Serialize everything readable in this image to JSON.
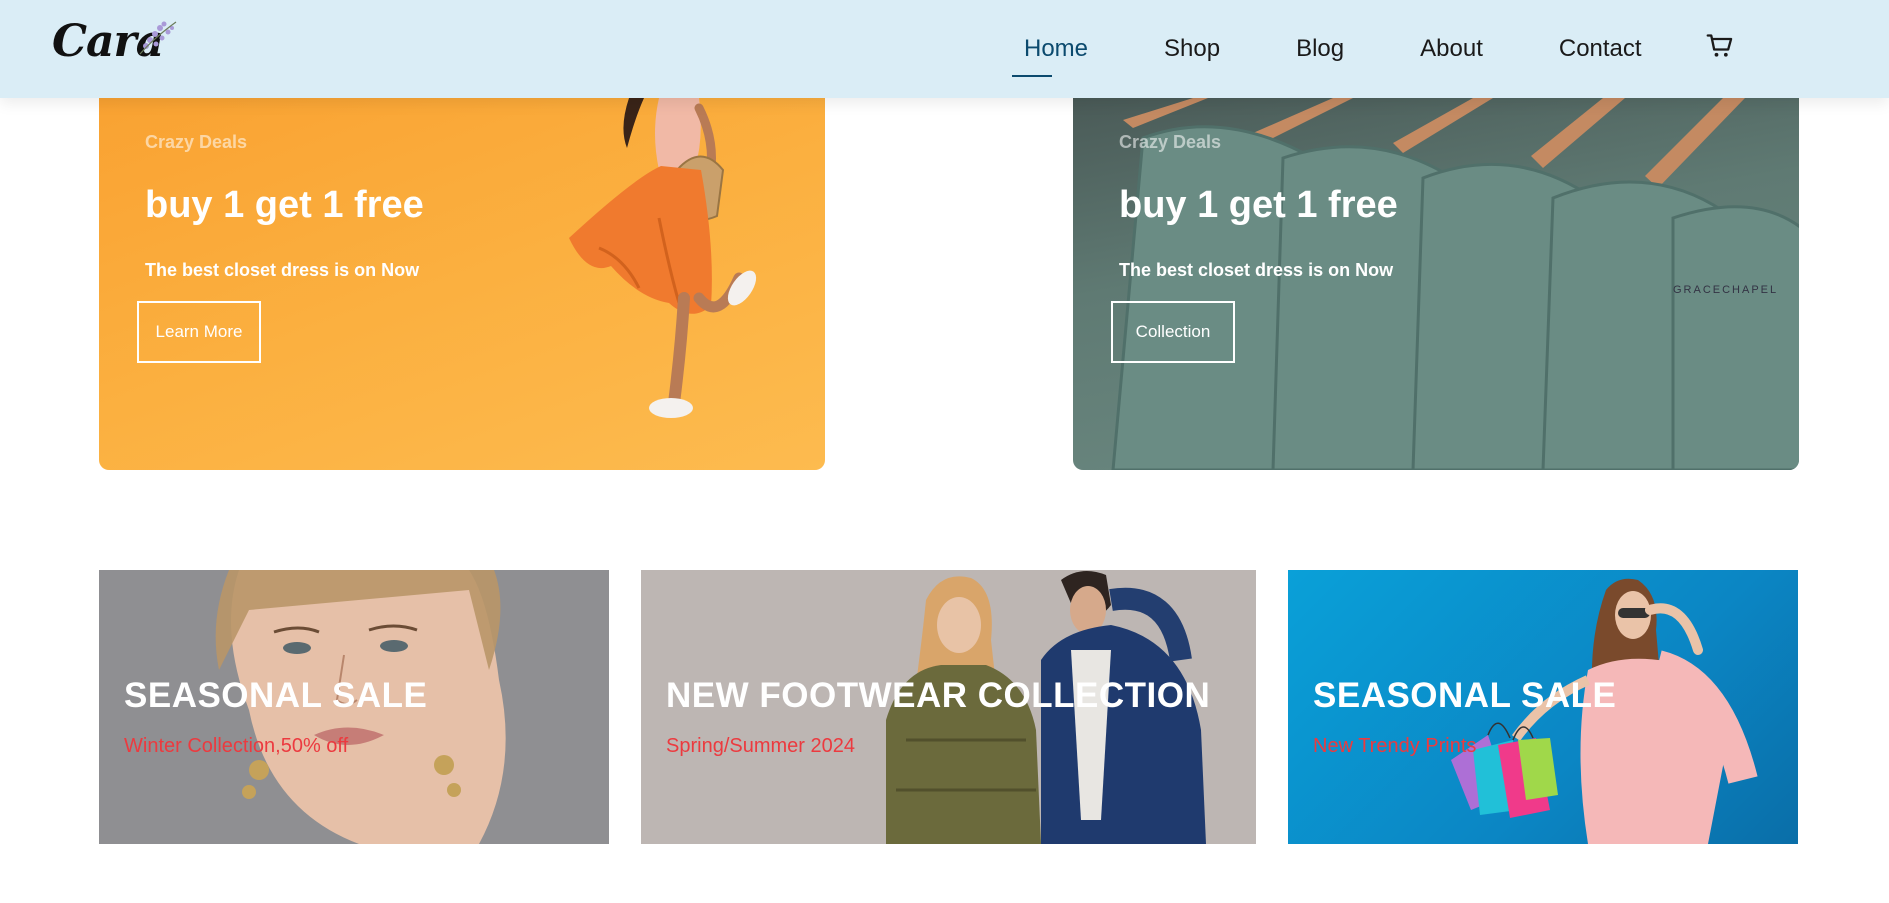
{
  "header": {
    "logo_text": "Cara",
    "nav": [
      "Home",
      "Shop",
      "Blog",
      "About",
      "Contact"
    ],
    "active_nav": "Home",
    "cart_icon": "cart-icon"
  },
  "banners": [
    {
      "tag": "Crazy Deals",
      "title": "buy 1 get 1 free",
      "subtitle": "The best closet dress is on Now",
      "button_label": "Learn More",
      "bg_color": "#fbb040"
    },
    {
      "tag": "Crazy Deals",
      "title": "buy 1 get 1 free",
      "subtitle": "The best closet dress is on Now",
      "button_label": "Collection",
      "bg_color": "#5f7a73"
    }
  ],
  "promos": [
    {
      "title": "SEASONAL SALE",
      "subtitle": "Winter Collection,50% off",
      "bg_color": "#8f8f92"
    },
    {
      "title": "NEW FOOTWEAR COLLECTION",
      "subtitle": "Spring/Summer 2024",
      "bg_color": "#bdb6b3"
    },
    {
      "title": "SEASONAL SALE",
      "subtitle": "New Trendy Prints",
      "bg_color": "#0b86c4"
    }
  ],
  "colors": {
    "header_bg": "#daedf6",
    "accent": "#0b4a6e",
    "promo_subtitle": "#ec3a3f"
  }
}
